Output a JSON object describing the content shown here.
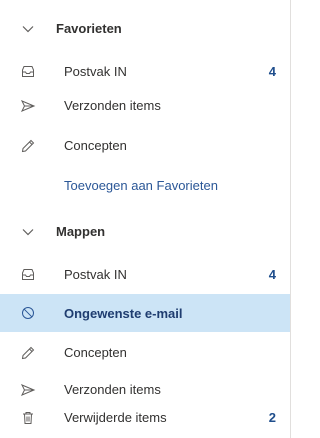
{
  "favorites": {
    "header": "Favorieten",
    "items": [
      {
        "label": "Postvak IN",
        "count": "4",
        "icon": "inbox-icon"
      },
      {
        "label": "Verzonden items",
        "count": "",
        "icon": "send-icon"
      },
      {
        "label": "Concepten",
        "count": "",
        "icon": "pencil-icon"
      }
    ],
    "add_link": "Toevoegen aan Favorieten"
  },
  "folders": {
    "header": "Mappen",
    "items": [
      {
        "label": "Postvak IN",
        "count": "4",
        "icon": "inbox-icon",
        "selected": false
      },
      {
        "label": "Ongewenste e-mail",
        "count": "",
        "icon": "blocked-icon",
        "selected": true
      },
      {
        "label": "Concepten",
        "count": "",
        "icon": "pencil-icon",
        "selected": false
      },
      {
        "label": "Verzonden items",
        "count": "",
        "icon": "send-icon",
        "selected": false
      },
      {
        "label": "Verwijderde items",
        "count": "2",
        "icon": "trash-icon",
        "selected": false
      }
    ]
  },
  "colors": {
    "selected_bg": "#cce4f6",
    "link": "#2b5797",
    "count": "#1f4e8c"
  }
}
